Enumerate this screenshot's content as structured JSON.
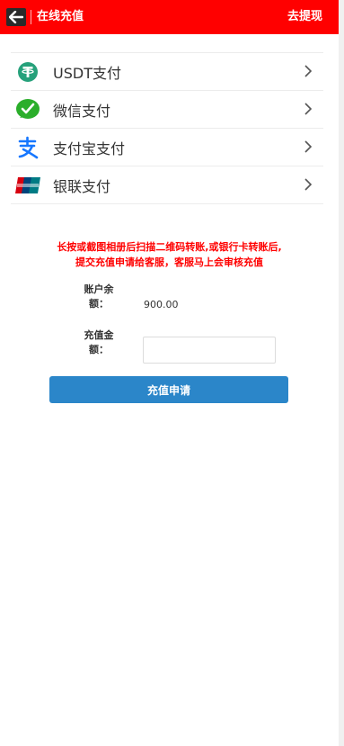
{
  "header": {
    "title": "在线充值",
    "action": "去提现",
    "color": "#ff0000"
  },
  "payment_methods": [
    {
      "label": "USDT支付",
      "icon": "usdt-icon",
      "color": "#26a17b"
    },
    {
      "label": "微信支付",
      "icon": "wechat-icon",
      "color": "#2aae2a"
    },
    {
      "label": "支付宝支付",
      "icon": "alipay-icon",
      "color": "#1677ff"
    },
    {
      "label": "银联支付",
      "icon": "unionpay-icon",
      "color": "#d7000f"
    }
  ],
  "notice": {
    "line1": "长按或截图相册后扫描二维码转账,或银行卡转账后,",
    "line2": "提交充值申请给客服，客服马上会审核充值"
  },
  "form": {
    "balance_label_1": "账户余",
    "balance_label_2": "额：",
    "balance_value": "900.00",
    "amount_label_1": "充值金",
    "amount_label_2": "额：",
    "amount_value": "",
    "submit_label": "充值申请",
    "button_color": "#2b86c9"
  }
}
